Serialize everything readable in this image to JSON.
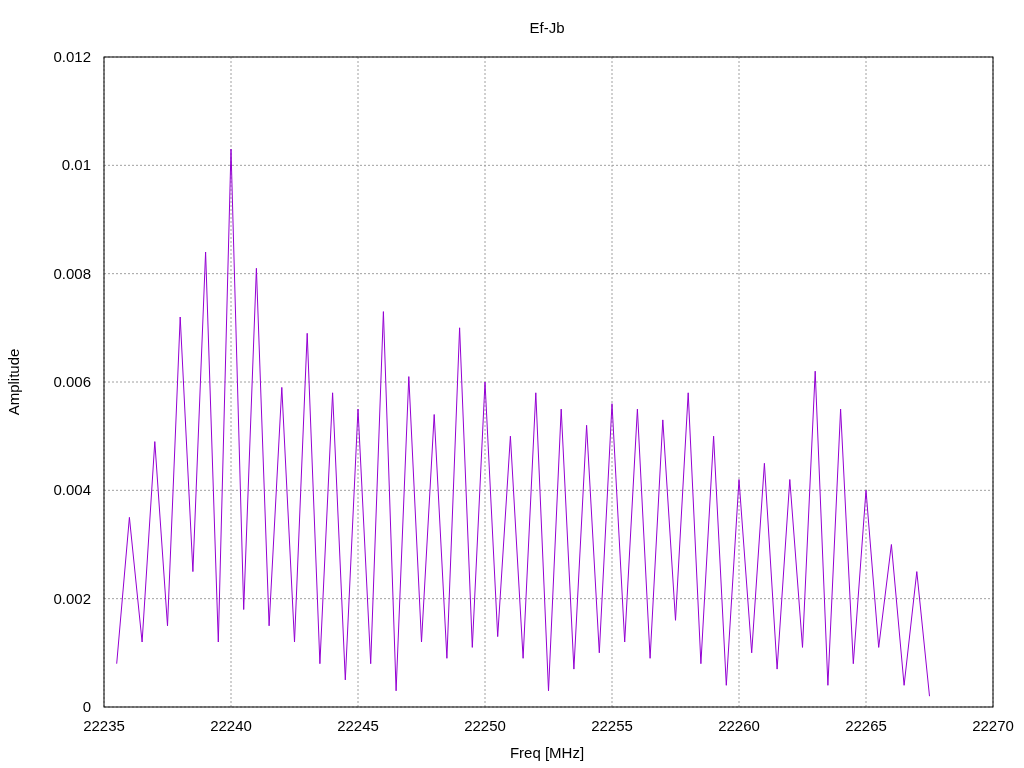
{
  "chart_data": {
    "type": "line",
    "grid": true,
    "title": "Ef-Jb",
    "xlabel": "Freq [MHz]",
    "ylabel": "Amplitude",
    "xlim": [
      22235,
      22270
    ],
    "ylim": [
      0,
      0.012
    ],
    "xticks": [
      22235,
      22240,
      22245,
      22250,
      22255,
      22260,
      22265,
      22270
    ],
    "yticks": [
      {
        "value": 0,
        "label": "0"
      },
      {
        "value": 0.002,
        "label": "0.002"
      },
      {
        "value": 0.004,
        "label": "0.004"
      },
      {
        "value": 0.006,
        "label": "0.006"
      },
      {
        "value": 0.008,
        "label": "0.008"
      },
      {
        "value": 0.01,
        "label": "0.01"
      },
      {
        "value": 0.012,
        "label": "0.012"
      }
    ],
    "x": [
      22235.5,
      22236,
      22236.5,
      22237,
      22237.5,
      22238,
      22238.5,
      22239,
      22239.5,
      22240,
      22240.5,
      22241,
      22241.5,
      22242,
      22242.5,
      22243,
      22243.5,
      22244,
      22244.5,
      22245,
      22245.5,
      22246,
      22246.5,
      22247,
      22247.5,
      22248,
      22248.5,
      22249,
      22249.5,
      22250,
      22250.5,
      22251,
      22251.5,
      22252,
      22252.5,
      22253,
      22253.5,
      22254,
      22254.5,
      22255,
      22255.5,
      22256,
      22256.5,
      22257,
      22257.5,
      22258,
      22258.5,
      22259,
      22259.5,
      22260,
      22260.5,
      22261,
      22261.5,
      22262,
      22262.5,
      22263,
      22263.5,
      22264,
      22264.5,
      22265,
      22265.5,
      22266,
      22266.5,
      22267,
      22267.5
    ],
    "series": [
      {
        "color": "#9400d3",
        "values": [
          0.0008,
          0.0035,
          0.0012,
          0.0049,
          0.0015,
          0.0072,
          0.0025,
          0.0084,
          0.0012,
          0.0103,
          0.0018,
          0.0081,
          0.0015,
          0.0059,
          0.0012,
          0.0069,
          0.0008,
          0.0058,
          0.0005,
          0.0055,
          0.0008,
          0.0073,
          0.0003,
          0.0061,
          0.0012,
          0.0054,
          0.0009,
          0.007,
          0.0011,
          0.006,
          0.0013,
          0.005,
          0.0009,
          0.0058,
          0.0003,
          0.0055,
          0.0007,
          0.0052,
          0.001,
          0.0056,
          0.0012,
          0.0055,
          0.0009,
          0.0053,
          0.0016,
          0.0058,
          0.0008,
          0.005,
          0.0004,
          0.0042,
          0.001,
          0.0045,
          0.0007,
          0.0042,
          0.0011,
          0.0062,
          0.0004,
          0.0055,
          0.0008,
          0.004,
          0.0011,
          0.003,
          0.0004,
          0.0025,
          0.0002
        ]
      }
    ]
  }
}
